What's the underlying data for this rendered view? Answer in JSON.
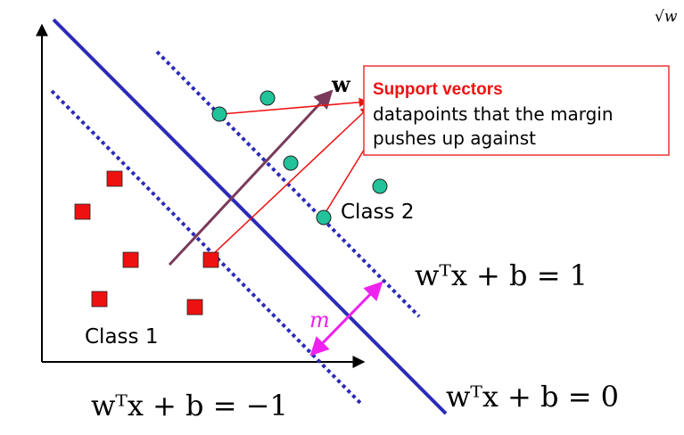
{
  "corner_text": "√w",
  "vector_label": "w",
  "margin_label": "m",
  "class1_label": "Class 1",
  "class2_label": "Class 2",
  "callout": {
    "title": "Support vectors",
    "line1": "datapoints that the margin",
    "line2": "pushes up against"
  },
  "equations": {
    "upper_margin": "wᵀx + b = 1",
    "lower_margin": "wᵀx + b = −1",
    "hyperplane": "wᵀx + b = 0"
  },
  "colors": {
    "hyperplane": "#2b2bb8",
    "margin": "#2b2bb8",
    "normal_vector": "#7a3a5a",
    "class1": "#ee1111",
    "class2": "#22c39a",
    "arrows": "#ee1111",
    "margin_width": "#ee22ee",
    "callout_border": "#ee3333"
  },
  "icons": {
    "class1_marker": "red-square",
    "class2_marker": "green-circle"
  }
}
